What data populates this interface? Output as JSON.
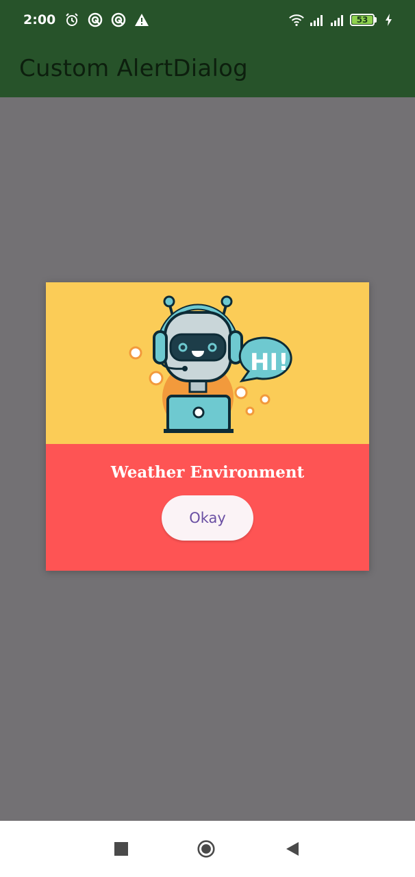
{
  "status_bar": {
    "time": "2:00",
    "left_icons": [
      "alarm-icon",
      "notification-icon",
      "notification-icon",
      "warning-icon"
    ],
    "right_icons": [
      "wifi-icon",
      "signal-icon",
      "signal-icon"
    ],
    "battery_level": "53",
    "charging": true
  },
  "app_bar": {
    "title": "Custom AlertDialog",
    "color": "#27532a"
  },
  "dialog": {
    "illustration": "robot-hi-illustration",
    "speech_bubble_text": "HI!",
    "title": "Weather Environment",
    "button_label": "Okay",
    "header_color": "#fbcc57",
    "body_color": "#fe5454"
  },
  "nav_bar": {
    "buttons": [
      "recent-apps-button",
      "home-button",
      "back-button"
    ]
  }
}
